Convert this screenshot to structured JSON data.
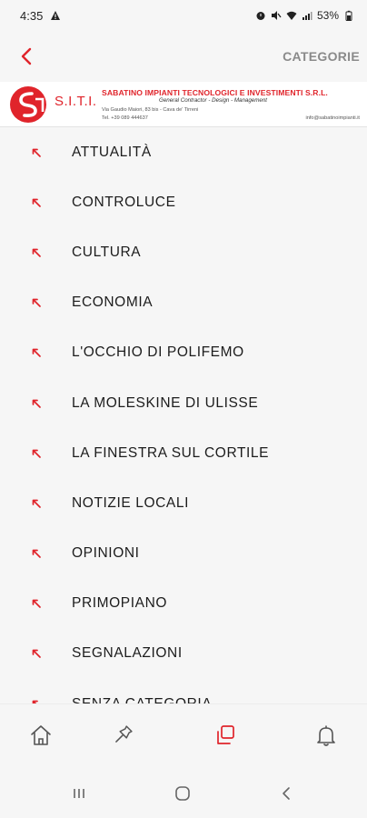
{
  "status_bar": {
    "time": "4:35",
    "battery": "53%"
  },
  "header": {
    "title": "CATEGORIE"
  },
  "banner": {
    "logo_text": "S.I.T.I.",
    "company": "SABATINO IMPIANTI TECNOLOGICI E INVESTIMENTI S.R.L.",
    "tagline": "General Contractor - Design - Management",
    "address": "Via Gaudio Maiori, 83 bis - Cava de' Tirreni",
    "phone": "Tel. +39 089 444637",
    "email": "info@sabatinoimpianti.it"
  },
  "categories": [
    {
      "label": "ATTUALITÀ"
    },
    {
      "label": "CONTROLUCE"
    },
    {
      "label": "CULTURA"
    },
    {
      "label": "ECONOMIA"
    },
    {
      "label": "L'OCCHIO DI POLIFEMO"
    },
    {
      "label": "LA MOLESKINE DI ULISSE"
    },
    {
      "label": "LA FINESTRA SUL CORTILE"
    },
    {
      "label": "NOTIZIE LOCALI"
    },
    {
      "label": "OPINIONI"
    },
    {
      "label": "PRIMOPIANO"
    },
    {
      "label": "SEGNALAZIONI"
    },
    {
      "label": "SENZA CATEGORIA"
    }
  ],
  "bottom_nav": [
    {
      "icon": "home-icon",
      "active": false
    },
    {
      "icon": "pin-icon",
      "active": false
    },
    {
      "icon": "categories-icon",
      "active": true
    },
    {
      "icon": "bell-icon",
      "active": false
    }
  ],
  "colors": {
    "accent": "#e0242b",
    "background": "#f6f6f6",
    "text": "#1c1c1c",
    "muted": "#8a8a8a"
  }
}
